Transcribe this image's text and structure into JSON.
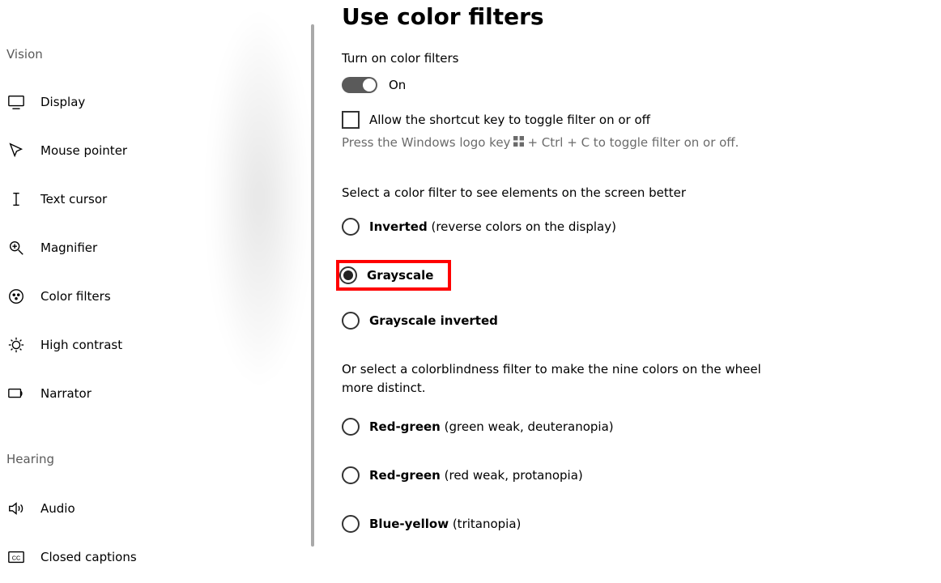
{
  "sidebar": {
    "sections": {
      "vision": "Vision",
      "hearing": "Hearing"
    },
    "visionItems": [
      {
        "label": "Display"
      },
      {
        "label": "Mouse pointer"
      },
      {
        "label": "Text cursor"
      },
      {
        "label": "Magnifier"
      },
      {
        "label": "Color filters"
      },
      {
        "label": "High contrast"
      },
      {
        "label": "Narrator"
      }
    ],
    "hearingItems": [
      {
        "label": "Audio"
      },
      {
        "label": "Closed captions"
      }
    ]
  },
  "main": {
    "title": "Use color filters",
    "turnOnLabel": "Turn on color filters",
    "toggleState": "On",
    "shortcutCheckbox": "Allow the shortcut key to toggle filter on or off",
    "shortcutHintA": "Press the Windows logo key",
    "shortcutHintB": "+ Ctrl + C to toggle filter on or off.",
    "selectFilterText": "Select a color filter to see elements on the screen better",
    "radios": {
      "inverted": {
        "bold": "Inverted",
        "rest": " (reverse colors on the display)"
      },
      "grayscale": {
        "bold": "Grayscale",
        "rest": ""
      },
      "grayscaleInverted": {
        "bold": "Grayscale inverted",
        "rest": ""
      }
    },
    "colorblindText": "Or select a colorblindness filter to make the nine colors on the wheel more distinct.",
    "cbRadios": {
      "rg1": {
        "bold": "Red-green",
        "rest": " (green weak, deuteranopia)"
      },
      "rg2": {
        "bold": "Red-green",
        "rest": " (red weak, protanopia)"
      },
      "by": {
        "bold": "Blue-yellow",
        "rest": " (tritanopia)"
      }
    }
  }
}
